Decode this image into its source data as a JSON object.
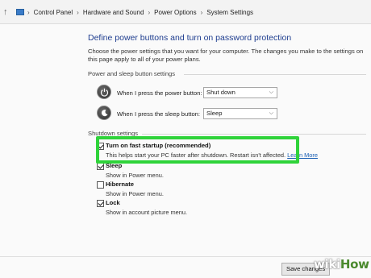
{
  "address_bar": {
    "breadcrumb": [
      "Control Panel",
      "Hardware and Sound",
      "Power Options",
      "System Settings"
    ],
    "separator": "›",
    "up_glyph": "↑"
  },
  "page": {
    "title": "Define power buttons and turn on password protection",
    "intro": "Choose the power settings that you want for your computer. The changes you make to the settings on this page apply to all of your power plans."
  },
  "power_sleep_section": {
    "label": "Power and sleep button settings",
    "rows": [
      {
        "label": "When I press the power button:",
        "value": "Shut down",
        "icon": "power-button-icon"
      },
      {
        "label": "When I press the sleep button:",
        "value": "Sleep",
        "icon": "sleep-button-icon"
      }
    ]
  },
  "shutdown_section": {
    "label": "Shutdown settings",
    "options": [
      {
        "title": "Turn on fast startup (recommended)",
        "desc": "This helps start your PC faster after shutdown. Restart isn't affected.",
        "link": "Learn More",
        "checked": true
      },
      {
        "title": "Sleep",
        "desc": "Show in Power menu.",
        "checked": true
      },
      {
        "title": "Hibernate",
        "desc": "Show in Power menu.",
        "checked": false
      },
      {
        "title": "Lock",
        "desc": "Show in account picture menu.",
        "checked": true
      }
    ]
  },
  "footer": {
    "save_label": "Save changes"
  },
  "watermark": {
    "wiki": "wiki",
    "how": "How"
  },
  "colors": {
    "highlight": "#2fd33a",
    "title": "#1e3d8f",
    "link": "#1a5fb4"
  }
}
